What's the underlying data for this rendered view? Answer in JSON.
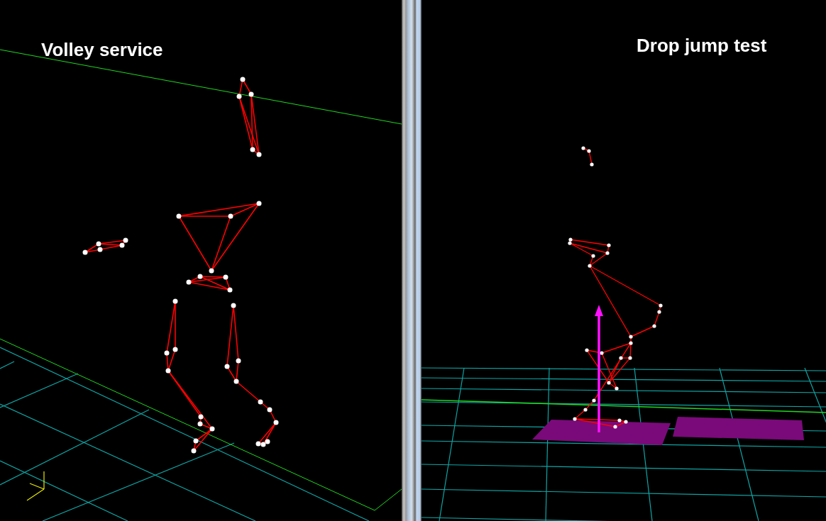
{
  "panels": [
    {
      "title": "Volley service"
    },
    {
      "title": "Drop jump test"
    }
  ]
}
